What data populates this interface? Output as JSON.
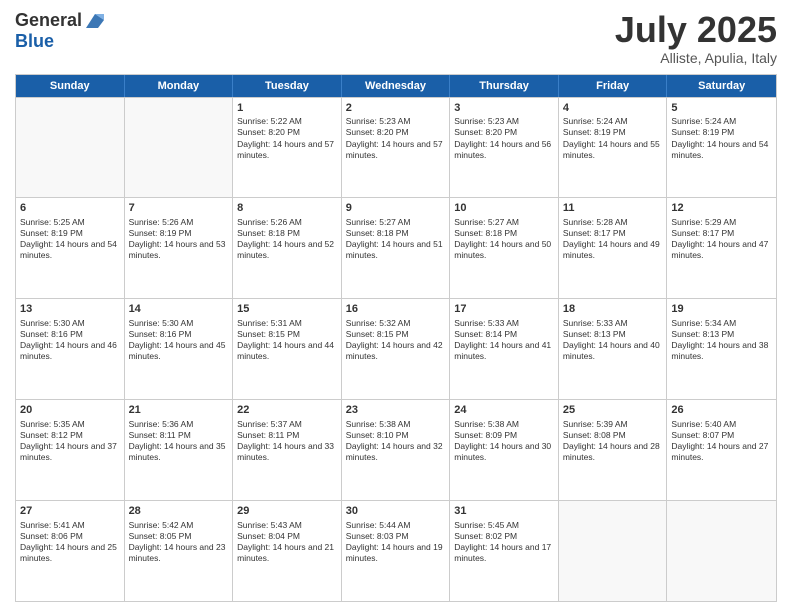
{
  "header": {
    "logo_general": "General",
    "logo_blue": "Blue",
    "month_title": "July 2025",
    "subtitle": "Alliste, Apulia, Italy"
  },
  "days_of_week": [
    "Sunday",
    "Monday",
    "Tuesday",
    "Wednesday",
    "Thursday",
    "Friday",
    "Saturday"
  ],
  "weeks": [
    [
      {
        "day": "",
        "sunrise": "",
        "sunset": "",
        "daylight": "",
        "empty": true
      },
      {
        "day": "",
        "sunrise": "",
        "sunset": "",
        "daylight": "",
        "empty": true
      },
      {
        "day": "1",
        "sunrise": "Sunrise: 5:22 AM",
        "sunset": "Sunset: 8:20 PM",
        "daylight": "Daylight: 14 hours and 57 minutes.",
        "empty": false
      },
      {
        "day": "2",
        "sunrise": "Sunrise: 5:23 AM",
        "sunset": "Sunset: 8:20 PM",
        "daylight": "Daylight: 14 hours and 57 minutes.",
        "empty": false
      },
      {
        "day": "3",
        "sunrise": "Sunrise: 5:23 AM",
        "sunset": "Sunset: 8:20 PM",
        "daylight": "Daylight: 14 hours and 56 minutes.",
        "empty": false
      },
      {
        "day": "4",
        "sunrise": "Sunrise: 5:24 AM",
        "sunset": "Sunset: 8:19 PM",
        "daylight": "Daylight: 14 hours and 55 minutes.",
        "empty": false
      },
      {
        "day": "5",
        "sunrise": "Sunrise: 5:24 AM",
        "sunset": "Sunset: 8:19 PM",
        "daylight": "Daylight: 14 hours and 54 minutes.",
        "empty": false
      }
    ],
    [
      {
        "day": "6",
        "sunrise": "Sunrise: 5:25 AM",
        "sunset": "Sunset: 8:19 PM",
        "daylight": "Daylight: 14 hours and 54 minutes.",
        "empty": false
      },
      {
        "day": "7",
        "sunrise": "Sunrise: 5:26 AM",
        "sunset": "Sunset: 8:19 PM",
        "daylight": "Daylight: 14 hours and 53 minutes.",
        "empty": false
      },
      {
        "day": "8",
        "sunrise": "Sunrise: 5:26 AM",
        "sunset": "Sunset: 8:18 PM",
        "daylight": "Daylight: 14 hours and 52 minutes.",
        "empty": false
      },
      {
        "day": "9",
        "sunrise": "Sunrise: 5:27 AM",
        "sunset": "Sunset: 8:18 PM",
        "daylight": "Daylight: 14 hours and 51 minutes.",
        "empty": false
      },
      {
        "day": "10",
        "sunrise": "Sunrise: 5:27 AM",
        "sunset": "Sunset: 8:18 PM",
        "daylight": "Daylight: 14 hours and 50 minutes.",
        "empty": false
      },
      {
        "day": "11",
        "sunrise": "Sunrise: 5:28 AM",
        "sunset": "Sunset: 8:17 PM",
        "daylight": "Daylight: 14 hours and 49 minutes.",
        "empty": false
      },
      {
        "day": "12",
        "sunrise": "Sunrise: 5:29 AM",
        "sunset": "Sunset: 8:17 PM",
        "daylight": "Daylight: 14 hours and 47 minutes.",
        "empty": false
      }
    ],
    [
      {
        "day": "13",
        "sunrise": "Sunrise: 5:30 AM",
        "sunset": "Sunset: 8:16 PM",
        "daylight": "Daylight: 14 hours and 46 minutes.",
        "empty": false
      },
      {
        "day": "14",
        "sunrise": "Sunrise: 5:30 AM",
        "sunset": "Sunset: 8:16 PM",
        "daylight": "Daylight: 14 hours and 45 minutes.",
        "empty": false
      },
      {
        "day": "15",
        "sunrise": "Sunrise: 5:31 AM",
        "sunset": "Sunset: 8:15 PM",
        "daylight": "Daylight: 14 hours and 44 minutes.",
        "empty": false
      },
      {
        "day": "16",
        "sunrise": "Sunrise: 5:32 AM",
        "sunset": "Sunset: 8:15 PM",
        "daylight": "Daylight: 14 hours and 42 minutes.",
        "empty": false
      },
      {
        "day": "17",
        "sunrise": "Sunrise: 5:33 AM",
        "sunset": "Sunset: 8:14 PM",
        "daylight": "Daylight: 14 hours and 41 minutes.",
        "empty": false
      },
      {
        "day": "18",
        "sunrise": "Sunrise: 5:33 AM",
        "sunset": "Sunset: 8:13 PM",
        "daylight": "Daylight: 14 hours and 40 minutes.",
        "empty": false
      },
      {
        "day": "19",
        "sunrise": "Sunrise: 5:34 AM",
        "sunset": "Sunset: 8:13 PM",
        "daylight": "Daylight: 14 hours and 38 minutes.",
        "empty": false
      }
    ],
    [
      {
        "day": "20",
        "sunrise": "Sunrise: 5:35 AM",
        "sunset": "Sunset: 8:12 PM",
        "daylight": "Daylight: 14 hours and 37 minutes.",
        "empty": false
      },
      {
        "day": "21",
        "sunrise": "Sunrise: 5:36 AM",
        "sunset": "Sunset: 8:11 PM",
        "daylight": "Daylight: 14 hours and 35 minutes.",
        "empty": false
      },
      {
        "day": "22",
        "sunrise": "Sunrise: 5:37 AM",
        "sunset": "Sunset: 8:11 PM",
        "daylight": "Daylight: 14 hours and 33 minutes.",
        "empty": false
      },
      {
        "day": "23",
        "sunrise": "Sunrise: 5:38 AM",
        "sunset": "Sunset: 8:10 PM",
        "daylight": "Daylight: 14 hours and 32 minutes.",
        "empty": false
      },
      {
        "day": "24",
        "sunrise": "Sunrise: 5:38 AM",
        "sunset": "Sunset: 8:09 PM",
        "daylight": "Daylight: 14 hours and 30 minutes.",
        "empty": false
      },
      {
        "day": "25",
        "sunrise": "Sunrise: 5:39 AM",
        "sunset": "Sunset: 8:08 PM",
        "daylight": "Daylight: 14 hours and 28 minutes.",
        "empty": false
      },
      {
        "day": "26",
        "sunrise": "Sunrise: 5:40 AM",
        "sunset": "Sunset: 8:07 PM",
        "daylight": "Daylight: 14 hours and 27 minutes.",
        "empty": false
      }
    ],
    [
      {
        "day": "27",
        "sunrise": "Sunrise: 5:41 AM",
        "sunset": "Sunset: 8:06 PM",
        "daylight": "Daylight: 14 hours and 25 minutes.",
        "empty": false
      },
      {
        "day": "28",
        "sunrise": "Sunrise: 5:42 AM",
        "sunset": "Sunset: 8:05 PM",
        "daylight": "Daylight: 14 hours and 23 minutes.",
        "empty": false
      },
      {
        "day": "29",
        "sunrise": "Sunrise: 5:43 AM",
        "sunset": "Sunset: 8:04 PM",
        "daylight": "Daylight: 14 hours and 21 minutes.",
        "empty": false
      },
      {
        "day": "30",
        "sunrise": "Sunrise: 5:44 AM",
        "sunset": "Sunset: 8:03 PM",
        "daylight": "Daylight: 14 hours and 19 minutes.",
        "empty": false
      },
      {
        "day": "31",
        "sunrise": "Sunrise: 5:45 AM",
        "sunset": "Sunset: 8:02 PM",
        "daylight": "Daylight: 14 hours and 17 minutes.",
        "empty": false
      },
      {
        "day": "",
        "sunrise": "",
        "sunset": "",
        "daylight": "",
        "empty": true
      },
      {
        "day": "",
        "sunrise": "",
        "sunset": "",
        "daylight": "",
        "empty": true
      }
    ]
  ]
}
